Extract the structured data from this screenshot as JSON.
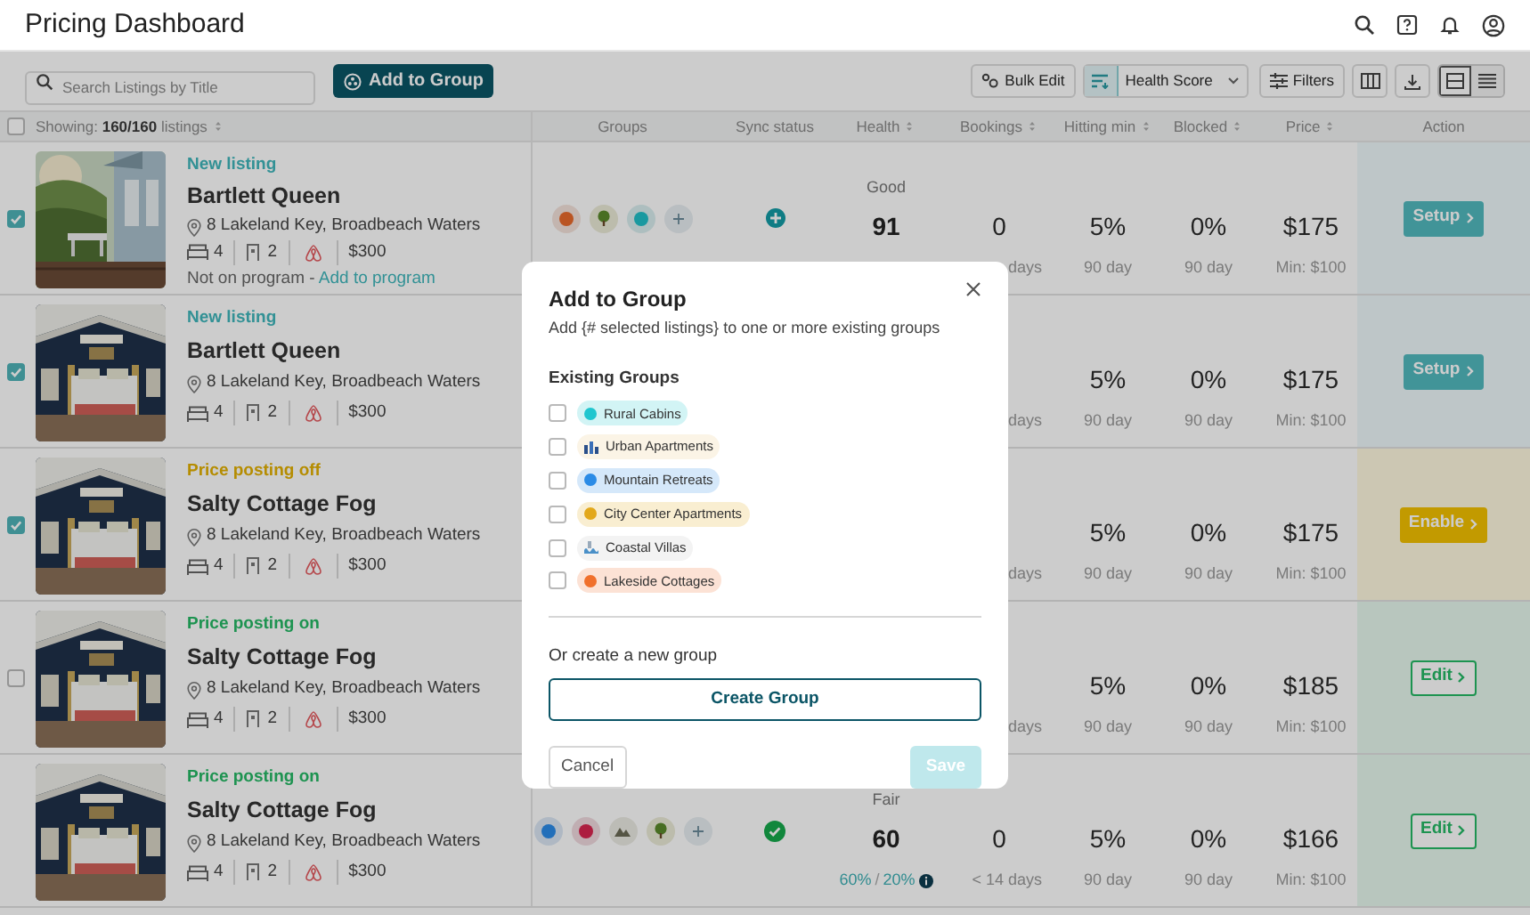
{
  "header": {
    "title": "Pricing Dashboard"
  },
  "toolbar": {
    "search": {
      "placeholder": "Search Listings by Title"
    },
    "add_button": "Add to Group",
    "bulk_edit": "Bulk Edit",
    "sort": "Health Score",
    "filters": "Filters",
    "view_modes": [
      {
        "kind": "cards",
        "selected": true
      },
      {
        "kind": "list",
        "selected": false
      }
    ]
  },
  "table": {
    "select_all": {
      "checked": false
    },
    "showing": "Showing: **160/160** listings",
    "columns": [
      {
        "label": "Groups",
        "sortable": false
      },
      {
        "label": "Sync status",
        "sortable": false
      },
      {
        "label": "Health",
        "sortable": true
      },
      {
        "label": "Bookings",
        "sortable": true
      },
      {
        "label": "Hitting min",
        "sortable": true
      },
      {
        "label": "Blocked",
        "sortable": true
      },
      {
        "label": "Price",
        "sortable": true
      },
      {
        "label": "Action",
        "sortable": false
      }
    ],
    "rows": [
      {
        "selected": true,
        "status": {
          "text": "New listing",
          "kind": "new"
        },
        "name": "Bartlett Queen",
        "address": "8 Lakeland Key, Broadbeach Waters",
        "beds": "4",
        "baths": "2",
        "rate": "$300",
        "note": {
          "text": "Not on program - ",
          "link": "Add to program"
        },
        "groups": [
          {
            "kind": "dot",
            "color": "#ba5422"
          },
          {
            "kind": "tree"
          },
          {
            "kind": "dot",
            "color": "#1999a0"
          },
          {
            "kind": "add"
          }
        ],
        "sync": {
          "kind": "pending"
        },
        "health": {
          "label": "Good",
          "score": "91"
        },
        "bookings": {
          "value": "0",
          "period": "days"
        },
        "hitting_min": {
          "value": "5%",
          "period": "90 day"
        },
        "blocked": {
          "value": "0%",
          "period": "90 day"
        },
        "price": {
          "value": "$175",
          "period": "Min: $100"
        },
        "action": {
          "label": "Setup",
          "kind": "setup"
        }
      },
      {
        "selected": true,
        "status": {
          "text": "New listing",
          "kind": "new"
        },
        "name": "Bartlett Queen",
        "address": "8 Lakeland Key, Broadbeach Waters",
        "beds": "4",
        "baths": "2",
        "rate": "$300",
        "bookings": {
          "period": "days"
        },
        "hitting_min": {
          "value": "5%",
          "period": "90 day"
        },
        "blocked": {
          "value": "0%",
          "period": "90 day"
        },
        "price": {
          "value": "$175",
          "period": "Min: $100"
        },
        "action": {
          "label": "Setup",
          "kind": "setup"
        }
      },
      {
        "selected": true,
        "status": {
          "text": "Price posting off",
          "kind": "off"
        },
        "name": "Salty Cottage Fog",
        "address": "8 Lakeland Key, Broadbeach Waters",
        "beds": "4",
        "baths": "2",
        "rate": "$300",
        "bookings": {
          "period": "days"
        },
        "hitting_min": {
          "value": "5%",
          "period": "90 day"
        },
        "blocked": {
          "value": "0%",
          "period": "90 day"
        },
        "price": {
          "value": "$175",
          "period": "Min: $100"
        },
        "action": {
          "label": "Enable",
          "kind": "enable"
        }
      },
      {
        "selected": false,
        "status": {
          "text": "Price posting on",
          "kind": "on"
        },
        "name": "Salty Cottage Fog",
        "address": "8 Lakeland Key, Broadbeach Waters",
        "beds": "4",
        "baths": "2",
        "rate": "$300",
        "bookings": {
          "period": "days"
        },
        "hitting_min": {
          "value": "5%",
          "period": "90 day"
        },
        "blocked": {
          "value": "0%",
          "period": "90 day"
        },
        "price": {
          "value": "$185",
          "period": "Min: $100"
        },
        "action": {
          "label": "Edit",
          "kind": "edit"
        }
      },
      {
        "status": {
          "text": "Price posting on",
          "kind": "on"
        },
        "name": "Salty Cottage Fog",
        "address": "8 Lakeland Key, Broadbeach Waters",
        "beds": "4",
        "baths": "2",
        "rate": "$300",
        "groups": [
          {
            "kind": "dot",
            "color": "#226fba"
          },
          {
            "kind": "dot",
            "color": "#ad1d3f"
          },
          {
            "kind": "mountain"
          },
          {
            "kind": "tree"
          },
          {
            "kind": "add"
          }
        ],
        "sync": {
          "kind": "synced"
        },
        "health": {
          "label": "Fair",
          "score": "60",
          "sub": [
            {
              "text": "60%",
              "kind": "rate"
            },
            {
              "text": "/",
              "kind": "sep"
            },
            {
              "text": "20%",
              "kind": "rate"
            }
          ],
          "info": true
        },
        "bookings": {
          "value": "0",
          "period": "< 14 days"
        },
        "hitting_min": {
          "value": "5%",
          "period": "90 day"
        },
        "blocked": {
          "value": "0%",
          "period": "90 day"
        },
        "price": {
          "value": "$166",
          "period": "Min: $100"
        },
        "action": {
          "label": "Edit",
          "kind": "edit"
        }
      }
    ]
  },
  "modal": {
    "title": "Add to Group",
    "subtitle": "Add {# selected listings} to one or more existing groups",
    "section": "Existing Groups",
    "groups": [
      {
        "label": "Rural Cabins",
        "kind": "dot",
        "color": "#1fc6cf",
        "checked": false
      },
      {
        "label": "Urban Apartments",
        "kind": "buildings",
        "checked": false
      },
      {
        "label": "Mountain Retreats",
        "kind": "dot",
        "color": "#2b8be6",
        "checked": false
      },
      {
        "label": "City Center Apartments",
        "kind": "dot",
        "color": "#e2a81b",
        "checked": false
      },
      {
        "label": "Coastal Villas",
        "kind": "waves",
        "checked": false
      },
      {
        "label": "Lakeside Cottages",
        "kind": "dot",
        "color": "#f0702c",
        "checked": false
      }
    ],
    "new_group_label": "Or create a new group",
    "create_button": "Create Group",
    "cancel_button": "Cancel",
    "save_button": {
      "label": "Save",
      "disabled": true
    }
  }
}
